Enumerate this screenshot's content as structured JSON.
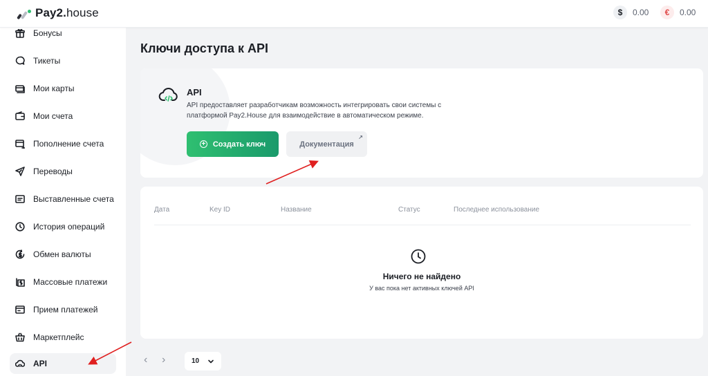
{
  "header": {
    "logo_bold": "Pay2.",
    "logo_light": "house",
    "balances": [
      {
        "symbol": "$",
        "amount": "0.00"
      },
      {
        "symbol": "€",
        "amount": "0.00"
      }
    ]
  },
  "sidebar": {
    "items": [
      {
        "label": "Бонусы",
        "icon": "gift-icon"
      },
      {
        "label": "Тикеты",
        "icon": "chat-icon"
      },
      {
        "label": "Мои карты",
        "icon": "cards-icon"
      },
      {
        "label": "Мои счета",
        "icon": "wallet-icon"
      },
      {
        "label": "Пополнение счета",
        "icon": "topup-icon"
      },
      {
        "label": "Переводы",
        "icon": "send-icon"
      },
      {
        "label": "Выставленные счета",
        "icon": "invoice-icon"
      },
      {
        "label": "История операций",
        "icon": "history-icon"
      },
      {
        "label": "Обмен валюты",
        "icon": "exchange-icon"
      },
      {
        "label": "Массовые платежи",
        "icon": "mass-payments-icon"
      },
      {
        "label": "Прием платежей",
        "icon": "receive-payments-icon"
      },
      {
        "label": "Маркетплейс",
        "icon": "basket-icon"
      },
      {
        "label": "API",
        "icon": "cloud-code-icon",
        "active": true
      }
    ]
  },
  "main": {
    "title": "Ключи доступа к API",
    "api_card": {
      "title": "API",
      "description": "API предоставляет разработчикам возможность интегрировать свои системы с платформой Pay2.House для взаимодействие в автоматическом режиме.",
      "create_label": "Создать ключ",
      "docs_label": "Документация"
    },
    "table": {
      "columns": [
        "Дата",
        "Key ID",
        "Название",
        "Статус",
        "Последнее использование"
      ],
      "empty_title": "Ничего не найдено",
      "empty_subtitle": "У вас пока нет активных ключей API"
    },
    "pagination": {
      "per_page": "10"
    }
  },
  "colors": {
    "accent_green": "#2fbf71",
    "annotation_red": "#e02020"
  }
}
